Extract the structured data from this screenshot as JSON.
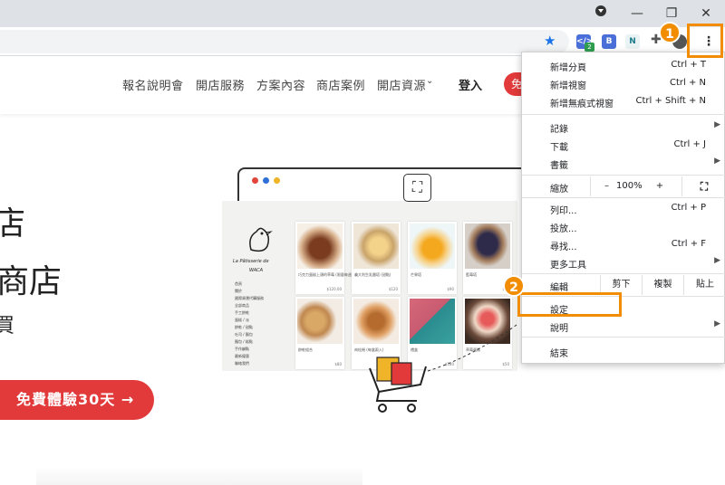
{
  "colors": {
    "accent": "#e23a3a",
    "highlight": "#f28c00",
    "chrome": "#dee1e6"
  },
  "browser": {
    "window_controls": [
      "minimize-icon",
      "restore-icon",
      "close-icon"
    ],
    "extensions": {
      "badge_count": "2"
    }
  },
  "site": {
    "nav": [
      "報名說明會",
      "開店服務",
      "方案內容",
      "商店案例",
      "開店資源"
    ],
    "login": "登入",
    "nav_cta": "免",
    "hero": {
      "line1": "店",
      "line2": "商店",
      "line3": "買"
    },
    "hero_cta": "免費體驗30天 →",
    "illustration": {
      "store_name_1": "La Pâtisserie de",
      "store_name_2": "WACA",
      "categories": [
        "首頁",
        "關於",
        "國際貨運代購服務",
        "全部商品",
        "手工餅乾",
        "蛋糕 / 派",
        "餅乾 / 甜點",
        "吐司 / 麵包",
        "麵包 / 糕點",
        "手作鹹點",
        "最新優惠",
        "聯絡我們"
      ],
      "cards": [
        {
          "title": "巧克力蛋糕上頭的草莓 (限量每週)",
          "price": "$120.00"
        },
        {
          "title": "義大利生乳酪塔 (甜點)",
          "price": "$120"
        },
        {
          "title": "芒果塔",
          "price": "$90"
        },
        {
          "title": "藍莓塔",
          "price": "$60"
        },
        {
          "title": "餅乾組合",
          "price": "$80"
        },
        {
          "title": "肉桂捲 (每盒兩入)",
          "price": "$120"
        },
        {
          "title": "禮盒",
          "price": "$180"
        },
        {
          "title": "草莓蛋糕",
          "price": "$50"
        }
      ]
    }
  },
  "menu": {
    "items": [
      {
        "label": "新增分頁",
        "shortcut": "Ctrl + T"
      },
      {
        "label": "新增視窗",
        "shortcut": "Ctrl + N"
      },
      {
        "label": "新增無痕式視窗",
        "shortcut": "Ctrl + Shift + N"
      },
      {
        "label": "記錄",
        "shortcut": ""
      },
      {
        "label": "下載",
        "shortcut": "Ctrl + J"
      },
      {
        "label": "書籤",
        "shortcut": ""
      },
      {
        "label": "列印...",
        "shortcut": "Ctrl + P"
      },
      {
        "label": "投放...",
        "shortcut": ""
      },
      {
        "label": "尋找...",
        "shortcut": "Ctrl + F"
      },
      {
        "label": "更多工具",
        "shortcut": ""
      },
      {
        "label": "設定",
        "shortcut": ""
      },
      {
        "label": "說明",
        "shortcut": ""
      },
      {
        "label": "結束",
        "shortcut": ""
      }
    ],
    "zoom": {
      "label": "縮放",
      "minus": "–",
      "value": "100%",
      "plus": "+"
    },
    "edit": {
      "label": "編輯",
      "cut": "剪下",
      "copy": "複製",
      "paste": "貼上"
    }
  },
  "annotations": {
    "step1": "1",
    "step2": "2"
  }
}
